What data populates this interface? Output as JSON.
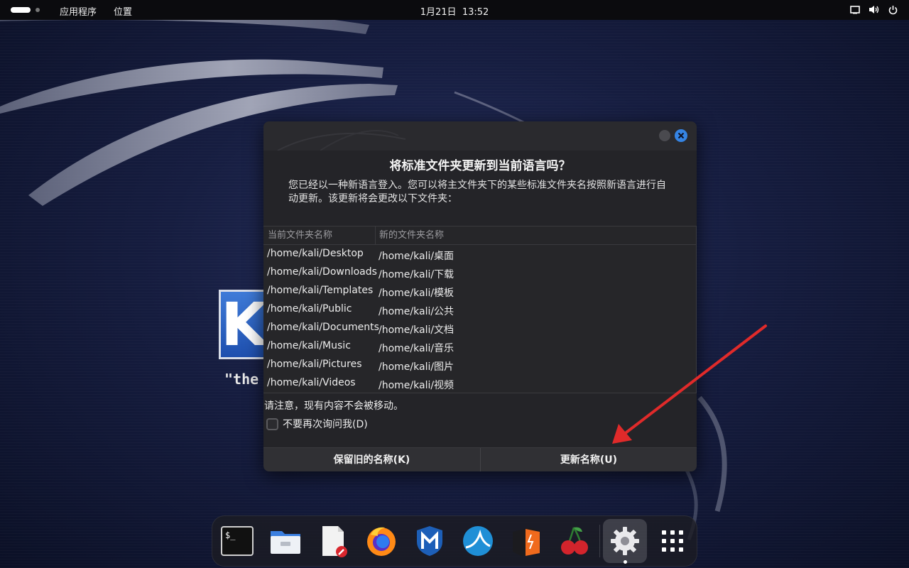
{
  "topbar": {
    "apps_menu": "应用程序",
    "places_menu": "位置",
    "date": "1月21日",
    "time": "13:52",
    "tray_icons": [
      "display-icon",
      "volume-icon",
      "power-icon"
    ]
  },
  "desktop": {
    "logo_letter": "K",
    "logo_tagline": "\"the"
  },
  "dialog": {
    "title": "将标准文件夹更新到当前语言吗？",
    "body": "您已经以一种新语言登入。您可以将主文件夹下的某些标准文件夹名按照新语言进行自动更新。该更新将会更改以下文件夹：",
    "table": {
      "headers": [
        "当前文件夹名称",
        "新的文件夹名称"
      ],
      "rows": [
        {
          "current": "/home/kali/Desktop",
          "new": "/home/kali/桌面"
        },
        {
          "current": "/home/kali/Downloads",
          "new": "/home/kali/下载"
        },
        {
          "current": "/home/kali/Templates",
          "new": "/home/kali/模板"
        },
        {
          "current": "/home/kali/Public",
          "new": "/home/kali/公共"
        },
        {
          "current": "/home/kali/Documents",
          "new": "/home/kali/文档"
        },
        {
          "current": "/home/kali/Music",
          "new": "/home/kali/音乐"
        },
        {
          "current": "/home/kali/Pictures",
          "new": "/home/kali/图片"
        },
        {
          "current": "/home/kali/Videos",
          "new": "/home/kali/视频"
        }
      ]
    },
    "note": "请注意，现有内容不会被移动。",
    "checkbox_label": "不要再次询问我(D)",
    "checkbox_checked": false,
    "keep_button": "保留旧的名称(K)",
    "update_button": "更新名称(U)",
    "accent_color": "#3584e4"
  },
  "annotation": {
    "arrow_color": "#e02a2a"
  },
  "dock": {
    "items": [
      "terminal-icon",
      "files-icon",
      "text-editor-icon",
      "firefox-icon",
      "metasploit-icon",
      "wireshark-icon",
      "burpsuite-icon",
      "cherrytree-icon",
      "settings-icon",
      "app-grid-icon"
    ],
    "active_item": "settings-icon"
  }
}
